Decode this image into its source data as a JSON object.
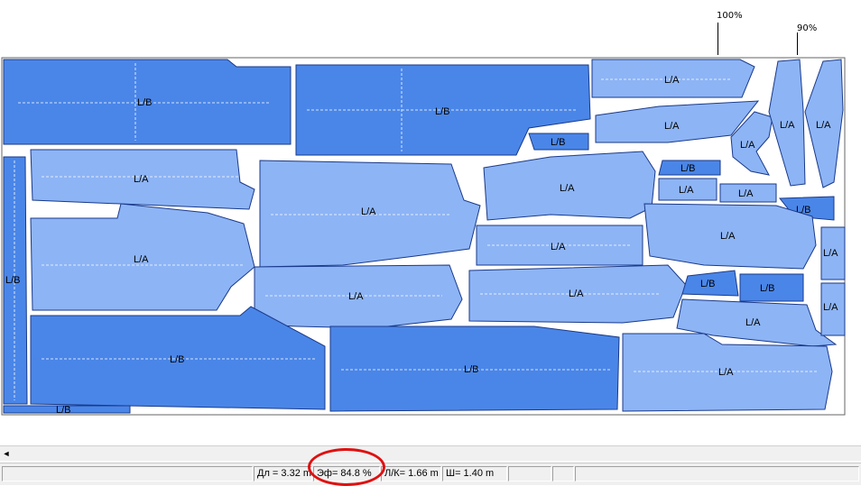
{
  "ruler": {
    "mark_100": "100%",
    "mark_90": "90%"
  },
  "pieces": {
    "lb": "L/B",
    "la": "L/A"
  },
  "colors": {
    "lb_fill": "#4a86e8",
    "la_fill": "#8db4f5",
    "outline": "#1a3a8a",
    "annotation": "#e01010"
  },
  "scrollbar": {
    "left_arrow": "◄"
  },
  "status": {
    "length": "Дл = 3.32 m",
    "efficiency": "Эф= 84.8 %",
    "ratio": "Л/К= 1.66 m",
    "width": "Ш= 1.40 m"
  }
}
